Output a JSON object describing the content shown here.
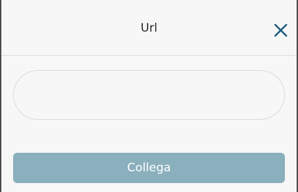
{
  "dialog": {
    "title": "Url",
    "close_icon": "close-icon",
    "url_input": {
      "value": "",
      "placeholder": ""
    },
    "connect_label": "Collega"
  },
  "colors": {
    "accent": "#1d5a80",
    "button": "#8aafbd",
    "background": "#f7f7f7"
  }
}
